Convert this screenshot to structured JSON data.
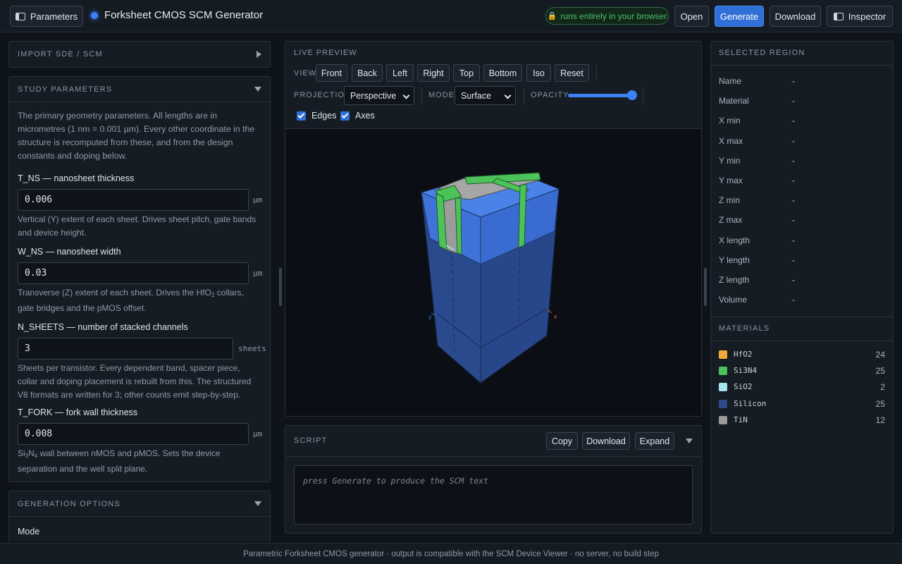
{
  "header": {
    "params_button": "Parameters",
    "app_title": "Forksheet CMOS SCM Generator",
    "badge": "runs entirely in your browser",
    "open": "Open",
    "generate": "Generate",
    "download": "Download",
    "inspector": "Inspector"
  },
  "left": {
    "import_title": "IMPORT SDE / SCM",
    "study_title": "STUDY PARAMETERS",
    "intro": "The primary geometry parameters. All lengths are in micrometres (1 nm = 0.001 µm). Every other coordinate in the structure is recomputed from these, and from the design constants and doping below.",
    "params": [
      {
        "label": "T_NS — nanosheet thickness",
        "value": "0.006",
        "unit": "µm",
        "help": "Vertical (Y) extent of each sheet. Drives sheet pitch, gate bands and device height."
      },
      {
        "label": "W_NS — nanosheet width",
        "value": "0.03",
        "unit": "µm",
        "help_a": "Transverse (Z) extent of each sheet. Drives the HfO",
        "help_sub": "2",
        "help_b": " collars, gate bridges and the pMOS offset."
      },
      {
        "label": "N_SHEETS — number of stacked channels",
        "value": "3",
        "unit": "sheets",
        "help": "Sheets per transistor. Every dependent band, spacer piece, collar and doping placement is rebuilt from this. The structured V8 formats are written for 3; other counts emit step-by-step."
      },
      {
        "label": "T_FORK — fork wall thickness",
        "value": "0.008",
        "unit": "µm",
        "help_a": "Si",
        "help_sub1": "3",
        "help_mid": "N",
        "help_sub2": "4",
        "help_b": " wall between nMOS and pMOS. Sets the device separation and the well split plane."
      }
    ],
    "gen_title": "GENERATION OPTIONS",
    "gen_mode_label": "Mode"
  },
  "preview": {
    "title": "LIVE PREVIEW",
    "view_label": "VIEW",
    "views": [
      "Front",
      "Back",
      "Left",
      "Right",
      "Top",
      "Bottom",
      "Iso",
      "Reset"
    ],
    "projection_label": "PROJECTION",
    "projection": "Perspective",
    "mode_label": "MODE",
    "mode": "Surface",
    "opacity_label": "OPACITY",
    "opacity": 0.95,
    "edges_label": "Edges",
    "edges": true,
    "axes_label": "Axes",
    "axes": true,
    "axis_x": "x",
    "axis_z": "z"
  },
  "script": {
    "title": "SCRIPT",
    "copy": "Copy",
    "download": "Download",
    "expand": "Expand",
    "placeholder": "press Generate to produce the SCM text"
  },
  "selected": {
    "title": "SELECTED REGION",
    "rows": [
      {
        "k": "Name",
        "v": "-"
      },
      {
        "k": "Material",
        "v": "-"
      },
      {
        "k": "X min",
        "v": "-"
      },
      {
        "k": "X max",
        "v": "-"
      },
      {
        "k": "Y min",
        "v": "-"
      },
      {
        "k": "Y max",
        "v": "-"
      },
      {
        "k": "Z min",
        "v": "-"
      },
      {
        "k": "Z max",
        "v": "-"
      },
      {
        "k": "X length",
        "v": "-"
      },
      {
        "k": "Y length",
        "v": "-"
      },
      {
        "k": "Z length",
        "v": "-"
      },
      {
        "k": "Volume",
        "v": "-"
      }
    ]
  },
  "materials": {
    "title": "MATERIALS",
    "items": [
      {
        "name": "HfO2",
        "count": "24",
        "color": "#f2a93b"
      },
      {
        "name": "Si3N4",
        "count": "25",
        "color": "#4cc35a"
      },
      {
        "name": "SiO2",
        "count": "2",
        "color": "#a8e6ef"
      },
      {
        "name": "Silicon",
        "count": "25",
        "color": "#2c4a8c"
      },
      {
        "name": "TiN",
        "count": "12",
        "color": "#9a9a9a"
      }
    ]
  },
  "footer": "Parametric Forksheet CMOS generator · output is compatible with the SCM Device Viewer · no server, no build step"
}
